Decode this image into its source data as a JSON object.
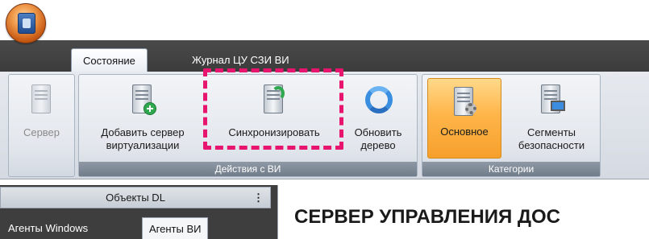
{
  "tabs": [
    "Состояние",
    "Журнал ЦУ СЗИ ВИ"
  ],
  "ribbon": {
    "server_label": "Сервер",
    "add_server_label": "Добавить сервер\nвиртуализации",
    "sync_label": "Синхронизировать",
    "refresh_label": "Обновить\nдерево",
    "vm_group_label": "Действия с ВИ",
    "main_label": "Основное",
    "segments_label": "Сегменты\nбезопасности",
    "categories_group_label": "Категории"
  },
  "left_pane": {
    "header": "Объекты DL",
    "menu_glyph": "⋮",
    "tabs": [
      "Агенты Windows",
      "Агенты ВИ"
    ]
  },
  "content": {
    "title": "СЕРВЕР УПРАВЛЕНИЯ ДОС"
  },
  "colors": {
    "highlight": "#e8156f",
    "selected": "#ffb54a",
    "tabstrip": "#3c3c3c"
  }
}
